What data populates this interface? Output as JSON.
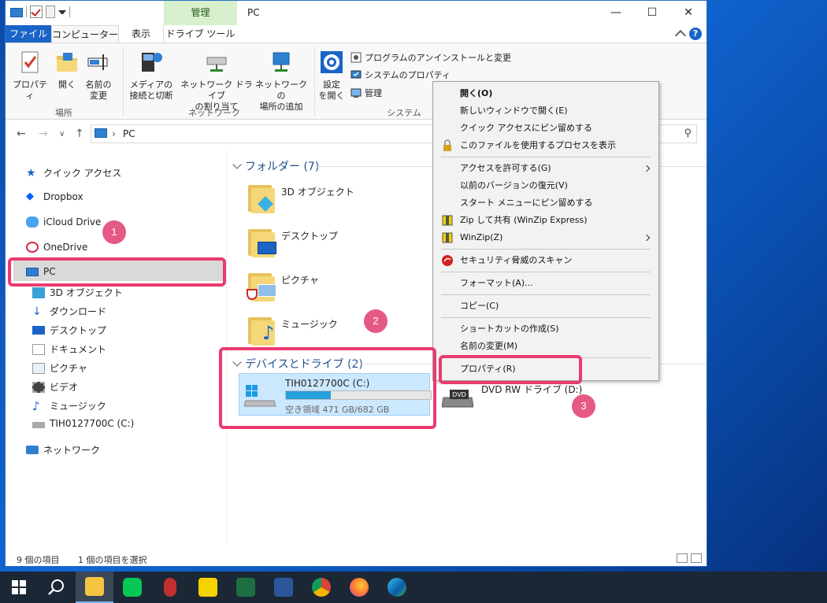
{
  "window": {
    "title": "PC",
    "contextual_tab_header": "管理",
    "controls": {
      "minimize": "—",
      "maximize": "☐",
      "close": "✕"
    }
  },
  "tabs": {
    "file": "ファイル",
    "computer": "コンピューター",
    "view": "表示",
    "drive_tools": "ドライブ ツール",
    "help": "?"
  },
  "ribbon": {
    "location": {
      "label": "場所",
      "properties": "プロパティ",
      "open": "開く",
      "rename_line1": "名前の",
      "rename_line2": "変更"
    },
    "network": {
      "label": "ネットワーク",
      "media_line1": "メディアの",
      "media_line2": "接続と切断",
      "map_drive_line1": "ネットワーク ドライブ",
      "map_drive_line2": "の割り当て",
      "add_location_line1": "ネットワークの",
      "add_location_line2": "場所の追加"
    },
    "system": {
      "label": "システム",
      "settings_line1": "設定",
      "settings_line2": "を開く",
      "uninstall": "プログラムのアンインストールと変更",
      "system_properties": "システムのプロパティ",
      "manage": "管理"
    }
  },
  "address": {
    "path": "PC",
    "chevron": "›"
  },
  "nav": {
    "quick_access": "クイック アクセス",
    "dropbox": "Dropbox",
    "icloud": "iCloud Drive",
    "onedrive": "OneDrive",
    "pc": "PC",
    "children": [
      "3D オブジェクト",
      "ダウンロード",
      "デスクトップ",
      "ドキュメント",
      "ピクチャ",
      "ビデオ",
      "ミュージック",
      "TIH0127700C (C:)"
    ],
    "network": "ネットワーク"
  },
  "content": {
    "folders_header": "フォルダー (7)",
    "folders": [
      "3D オブジェクト",
      "デスクトップ",
      "ピクチャ",
      "ミュージック"
    ],
    "devices_header": "デバイスとドライブ (2)",
    "drive_c": {
      "name": "TIH0127700C (C:)",
      "free": "空き領域 471 GB/682 GB",
      "used_fraction": 0.31
    },
    "dvd_drive": "DVD RW ドライブ (D:)",
    "dvd_label": "DVD"
  },
  "context_menu": {
    "items": [
      "開く(O)",
      "新しいウィンドウで開く(E)",
      "クイック アクセスにピン留めする",
      "このファイルを使用するプロセスを表示",
      "アクセスを許可する(G)",
      "以前のバージョンの復元(V)",
      "スタート メニューにピン留めする",
      "Zip して共有 (WinZip Express)",
      "WinZip(Z)",
      "セキュリティ脅威のスキャン",
      "フォーマット(A)...",
      "コピー(C)",
      "ショートカットの作成(S)",
      "名前の変更(M)",
      "プロパティ(R)"
    ]
  },
  "status": {
    "item_count": "9 個の項目",
    "selected": "1 個の項目を選択"
  },
  "annotations": {
    "badge1": "1",
    "badge2": "2",
    "badge3": "3",
    "color": "#ea3a6f"
  }
}
